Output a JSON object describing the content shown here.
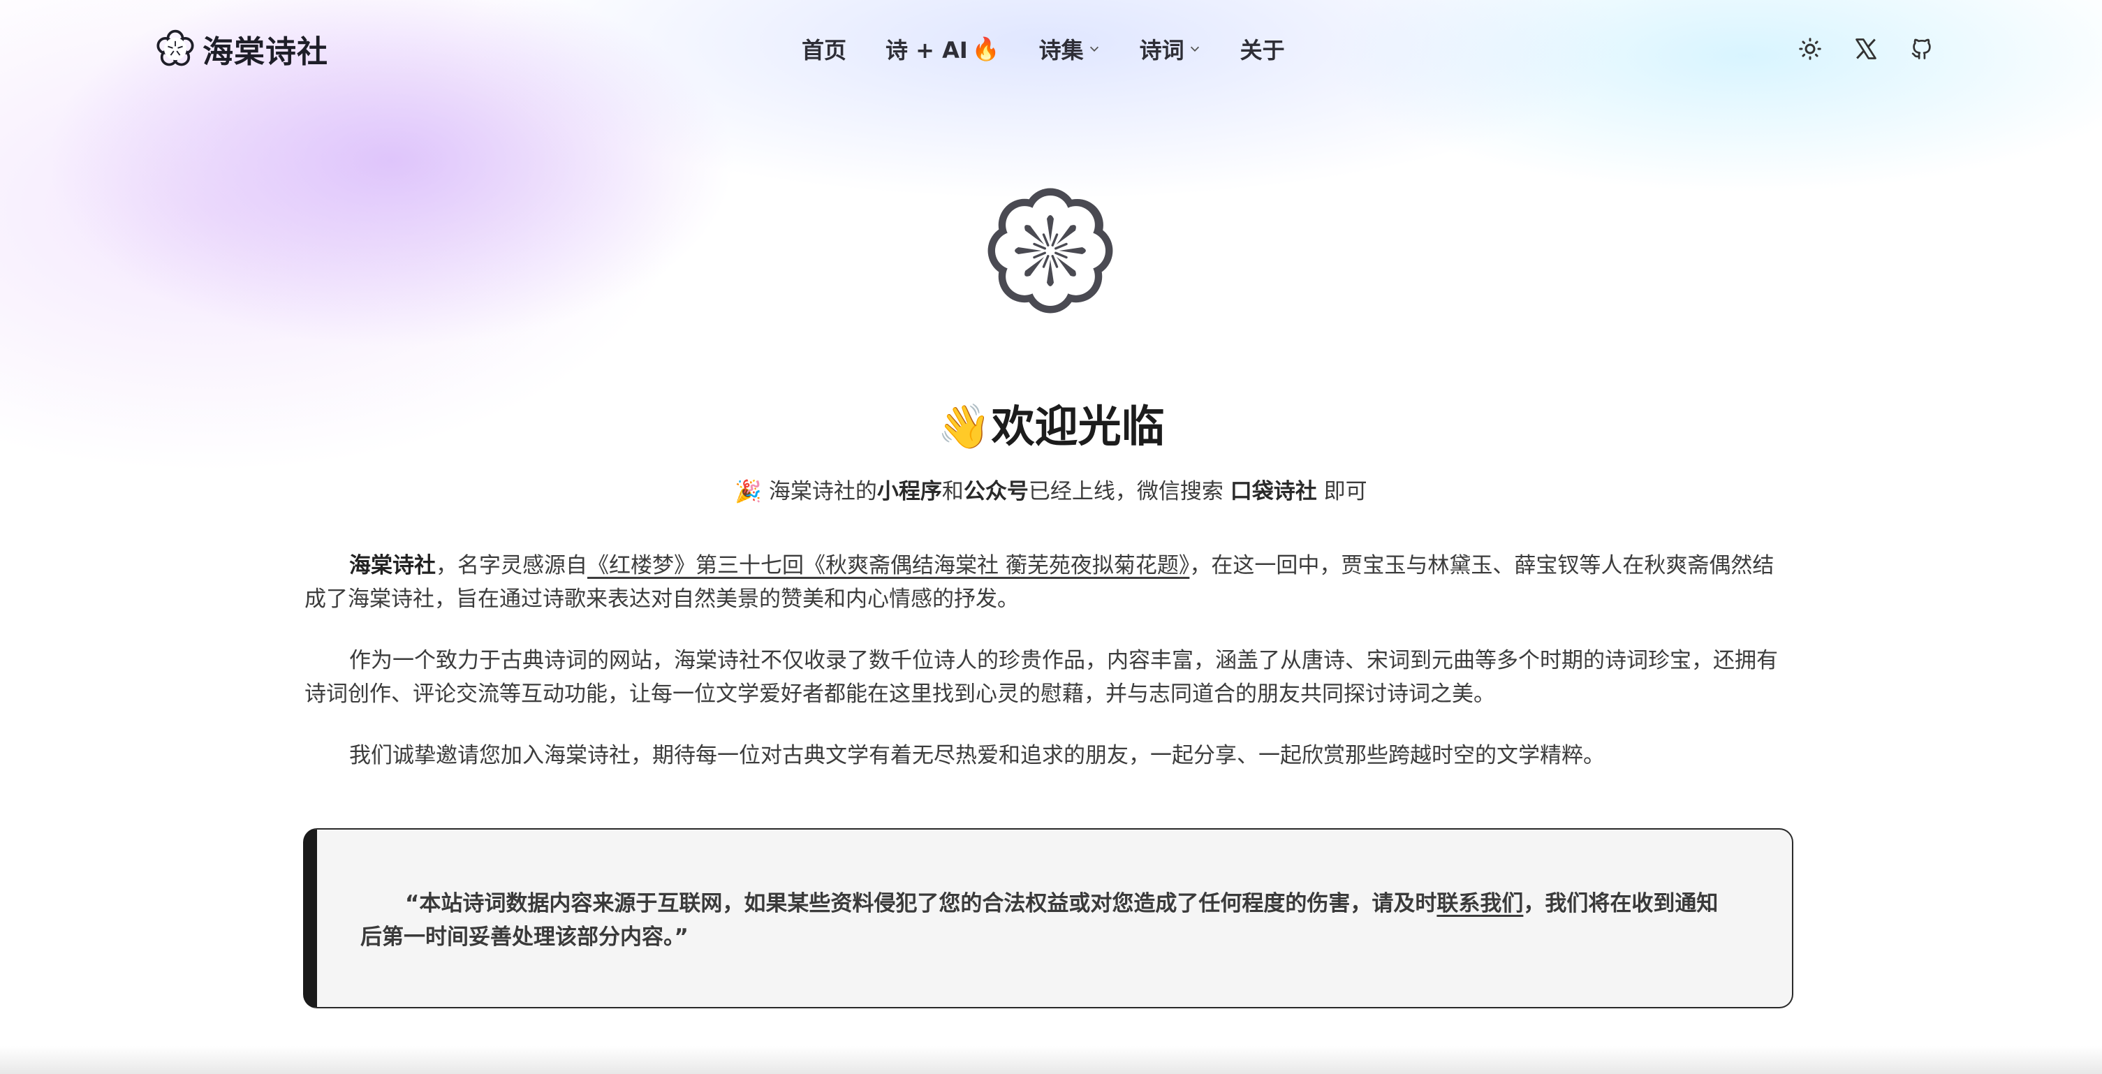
{
  "site": {
    "name": "海棠诗社"
  },
  "nav": {
    "items": [
      {
        "label": "首页"
      },
      {
        "label": "诗 + AI",
        "emoji": "🔥"
      },
      {
        "label": "诗集",
        "has_dropdown": true
      },
      {
        "label": "诗词",
        "has_dropdown": true
      },
      {
        "label": "关于"
      }
    ]
  },
  "header_icons": [
    "sun-icon",
    "x-icon",
    "github-icon"
  ],
  "hero": {
    "welcome_emoji": "👋",
    "welcome": "欢迎光临",
    "announce": {
      "emoji": "🎉",
      "p1": "海棠诗社的",
      "b1": "小程序",
      "p2": "和",
      "b2": "公众号",
      "p3": "已经上线，微信搜索 ",
      "b3": "口袋诗社",
      "p4": " 即可"
    }
  },
  "about": {
    "p1": {
      "bold": "海棠诗社",
      "before_link": "，名字灵感源自",
      "link": "《红楼梦》第三十七回《秋爽斋偶结海棠社 蘅芜苑夜拟菊花题》",
      "after_link": "，在这一回中，贾宝玉与林黛玉、薛宝钗等人在秋爽斋偶然结成了海棠诗社，旨在通过诗歌来表达对自然美景的赞美和内心情感的抒发。"
    },
    "p2": "作为一个致力于古典诗词的网站，海棠诗社不仅收录了数千位诗人的珍贵作品，内容丰富，涵盖了从唐诗、宋词到元曲等多个时期的诗词珍宝，还拥有诗词创作、评论交流等互动功能，让每一位文学爱好者都能在这里找到心灵的慰藉，并与志同道合的朋友共同探讨诗词之美。",
    "p3": "我们诚挚邀请您加入海棠诗社，期待每一位对古典文学有着无尽热爱和追求的朋友，一起分享、一起欣赏那些跨越时空的文学精粹。"
  },
  "notice": {
    "before_link": "“本站诗词数据内容来源于互联网，如果某些资料侵犯了您的合法权益或对您造成了任何程度的伤害，请及时",
    "link": "联系我们",
    "after_link": "，我们将在收到通知后第一时间妥善处理该部分内容。”"
  },
  "colors": {
    "text": "#3c3c3c",
    "heading": "#1c1c1c",
    "notice_bg": "#f5f5f5",
    "notice_border": "#1a1a1a",
    "bg_purple": "#d6b6fa",
    "bg_blue": "#c8f0ff"
  }
}
